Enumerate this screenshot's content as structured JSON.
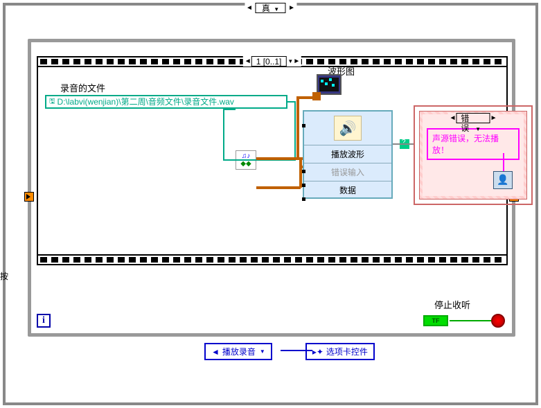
{
  "outer_case": {
    "value": "真"
  },
  "sequence": {
    "label": "1 [0..1]"
  },
  "labels": {
    "recording_file": "录音的文件",
    "waveform_graph": "波形图",
    "stop_listen": "停止收听"
  },
  "file_path": {
    "value": "D:\\labvi(wenjian)\\第二周\\音频文件\\录音文件.wav"
  },
  "play_vi": {
    "title": "播放波形",
    "error_in": "错误输入",
    "data": "数据"
  },
  "error_case": {
    "selector": "错误",
    "message": "声源错误，无法播放！"
  },
  "loop": {
    "index": "i",
    "tf": "TF"
  },
  "bottom": {
    "play_recording": "播放录音",
    "tab_control": "选项卡控件"
  },
  "help_marker": "?"
}
